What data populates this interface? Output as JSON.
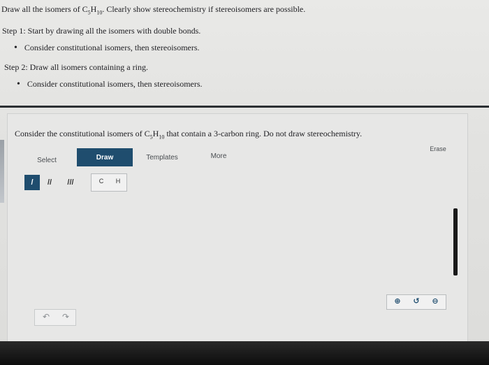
{
  "instructions": {
    "title_prefix": "Draw all the isomers of C",
    "title_sub1": "5",
    "title_mid": "H",
    "title_sub2": "10",
    "title_suffix": ". Clearly show stereochemistry if stereoisomers are possible.",
    "step1": "Step 1: Start by drawing all the isomers with double bonds.",
    "step1_bullet": "Consider constitutional isomers, then stereoisomers.",
    "step2": "Step 2: Draw all isomers containing a ring.",
    "step2_bullet": "Consider constitutional isomers, then stereoisomers."
  },
  "question": {
    "prefix": "Consider the constitutional isomers of C",
    "sub1": "5",
    "mid": "H",
    "sub2": "10",
    "suffix": " that contain a 3-carbon ring. Do not draw stereochemistry."
  },
  "toolbar": {
    "select": "Select",
    "draw": "Draw",
    "templates": "Templates",
    "more": "More",
    "erase": "Erase"
  },
  "tools": {
    "single_bond": "/",
    "double_bond": "//",
    "triple_bond": "///",
    "atom_c": "C",
    "atom_h": "H"
  },
  "icons": {
    "undo": "undo-icon",
    "redo": "redo-icon",
    "zoom_in": "zoom-in-icon",
    "zoom_reset": "zoom-reset-icon",
    "zoom_out": "zoom-out-icon"
  },
  "colors": {
    "accent": "#1f4d6e",
    "background": "#e5e5e3"
  }
}
